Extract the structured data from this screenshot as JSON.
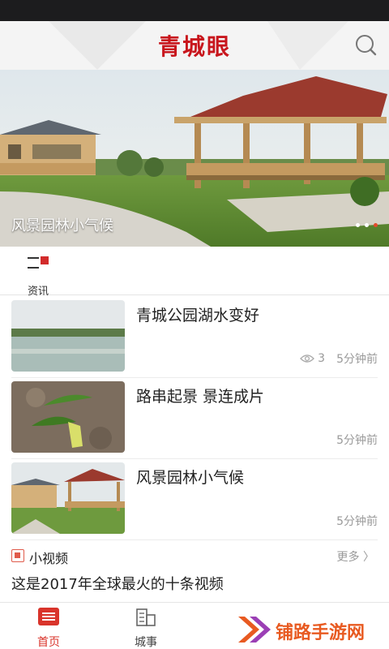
{
  "header": {
    "title": "青城眼"
  },
  "banner": {
    "caption": "风景园林小气候",
    "slides": 3,
    "active_slide": 3
  },
  "tabs": [
    {
      "label": "资讯",
      "icon": "news-tab-icon"
    }
  ],
  "news": [
    {
      "title": "青城公园湖水变好",
      "views": "3",
      "time": "5分钟前"
    },
    {
      "title": "路串起景 景连成片",
      "time": "5分钟前"
    },
    {
      "title": "风景园林小气候",
      "time": "5分钟前"
    }
  ],
  "video_section": {
    "label": "小视频",
    "more": "更多 〉",
    "item_title": "这是2017年全球最火的十条视频"
  },
  "bottom_nav": [
    {
      "label": "首页",
      "icon": "home-icon",
      "active": true
    },
    {
      "label": "城事",
      "icon": "city-icon",
      "active": false
    }
  ],
  "watermark": {
    "text": "铺路手游网"
  },
  "colors": {
    "brand": "#c8161d",
    "accent": "#e34b2c",
    "watermark": "#e85a21"
  }
}
